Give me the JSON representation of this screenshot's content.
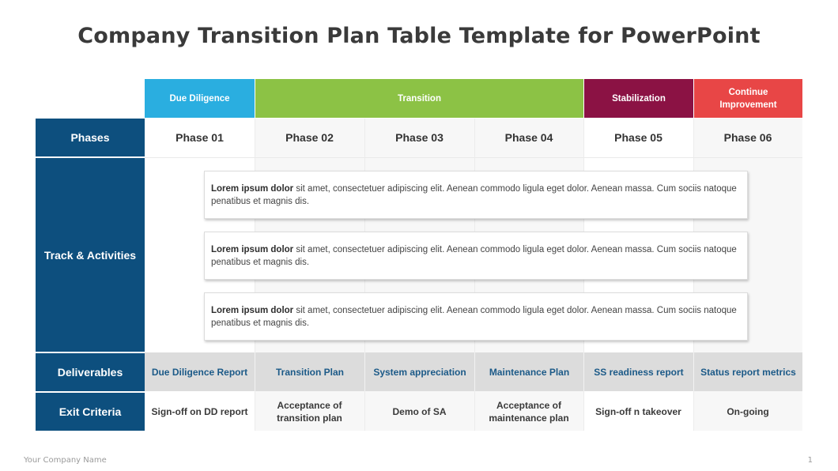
{
  "title": "Company Transition Plan Table Template for PowerPoint",
  "groups": [
    {
      "label": "Due Diligence",
      "color": "#2aaee0"
    },
    {
      "label": "Transition",
      "color": "#8cc245"
    },
    {
      "label": "Stabilization",
      "color": "#8b1244"
    },
    {
      "label": "Continue Improvement",
      "color": "#e84646"
    }
  ],
  "row_labels": {
    "phases": "Phases",
    "track": "Track & Activities",
    "deliverables": "Deliverables",
    "exit": "Exit Criteria"
  },
  "phases": [
    "Phase 01",
    "Phase 02",
    "Phase 03",
    "Phase 04",
    "Phase 05",
    "Phase 06"
  ],
  "activities": [
    {
      "bold": "Lorem ipsum dolor",
      "text": " sit amet, consectetuer adipiscing elit. Aenean commodo  ligula eget dolor.  Aenean massa. Cum sociis natoque penatibus et magnis dis."
    },
    {
      "bold": "Lorem ipsum dolor",
      "text": " sit amet, consectetuer adipiscing elit. Aenean commodo  ligula eget dolor.  Aenean massa. Cum sociis natoque penatibus et magnis dis."
    },
    {
      "bold": "Lorem ipsum dolor",
      "text": " sit amet, consectetuer adipiscing elit. Aenean commodo  ligula eget dolor.  Aenean massa. Cum sociis natoque penatibus et magnis dis."
    }
  ],
  "deliverables": [
    "Due Diligence Report",
    "Transition Plan",
    "System appreciation",
    "Maintenance Plan",
    "SS readiness report",
    "Status report metrics"
  ],
  "exit_criteria": [
    "Sign-off on DD report",
    "Acceptance of transition plan",
    "Demo of SA",
    "Acceptance of maintenance plan",
    "Sign-off n takeover",
    "On-going"
  ],
  "footer": {
    "company": "Your Company Name",
    "page": "1"
  },
  "colors": {
    "row_label_bg": "#0d4f7e",
    "deliverable_text": "#1c5a88",
    "deliverable_bg": "#dcdcdc"
  }
}
